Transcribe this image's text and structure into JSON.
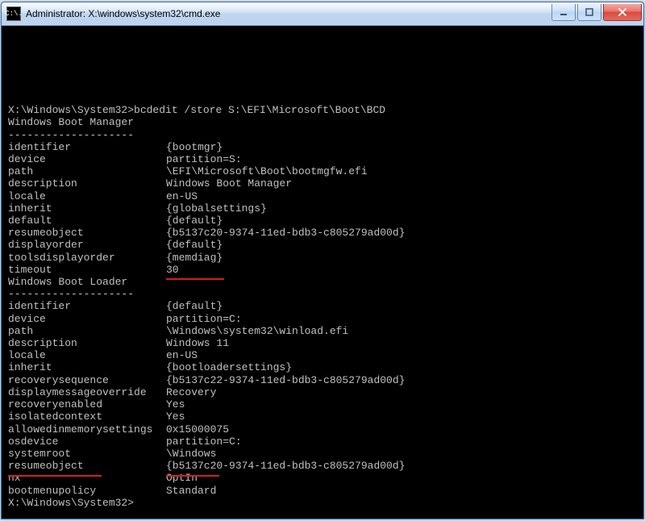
{
  "titlebar": {
    "icon_text": "C:\\.",
    "title": "Administrator: X:\\windows\\system32\\cmd.exe"
  },
  "prompt": "X:\\Windows\\System32>",
  "command": "bcdedit /store S:\\EFI\\Microsoft\\Boot\\BCD",
  "divider": "--------------------",
  "sections": [
    {
      "heading": "Windows Boot Manager",
      "rows": [
        {
          "k": "identifier",
          "v": "{bootmgr}"
        },
        {
          "k": "device",
          "v": "partition=S:"
        },
        {
          "k": "path",
          "v": "\\EFI\\Microsoft\\Boot\\bootmgfw.efi"
        },
        {
          "k": "description",
          "v": "Windows Boot Manager"
        },
        {
          "k": "locale",
          "v": "en-US"
        },
        {
          "k": "inherit",
          "v": "{globalsettings}"
        },
        {
          "k": "default",
          "v": "{default}"
        },
        {
          "k": "resumeobject",
          "v": "{b5137c20-9374-11ed-bdb3-c805279ad00d}"
        },
        {
          "k": "displayorder",
          "v": "{default}"
        },
        {
          "k": "toolsdisplayorder",
          "v": "{memdiag}"
        },
        {
          "k": "timeout",
          "v": "30"
        }
      ]
    },
    {
      "heading": "Windows Boot Loader",
      "rows": [
        {
          "k": "identifier",
          "v": "{default}"
        },
        {
          "k": "device",
          "v": "partition=C:"
        },
        {
          "k": "path",
          "v": "\\Windows\\system32\\winload.efi"
        },
        {
          "k": "description",
          "v": "Windows 11"
        },
        {
          "k": "locale",
          "v": "en-US"
        },
        {
          "k": "inherit",
          "v": "{bootloadersettings}"
        },
        {
          "k": "recoverysequence",
          "v": "{b5137c22-9374-11ed-bdb3-c805279ad00d}"
        },
        {
          "k": "displaymessageoverride",
          "v": "Recovery"
        },
        {
          "k": "recoveryenabled",
          "v": "Yes"
        },
        {
          "k": "isolatedcontext",
          "v": "Yes"
        },
        {
          "k": "allowedinmemorysettings",
          "v": "0x15000075"
        },
        {
          "k": "osdevice",
          "v": "partition=C:"
        },
        {
          "k": "systemroot",
          "v": "\\Windows"
        },
        {
          "k": "resumeobject",
          "v": "{b5137c20-9374-11ed-bdb3-c805279ad00d}"
        },
        {
          "k": "nx",
          "v": "OptIn"
        },
        {
          "k": "bootmenupolicy",
          "v": "Standard"
        }
      ]
    }
  ]
}
